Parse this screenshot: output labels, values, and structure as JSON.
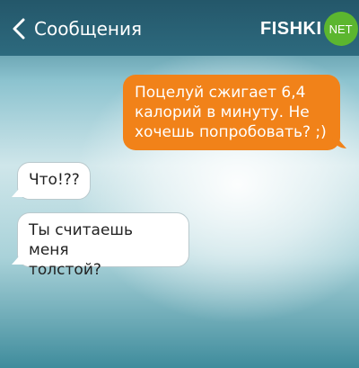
{
  "navbar": {
    "back_label": "Сообщения",
    "brand_main": "FISHKI",
    "brand_badge": "NET",
    "colors": {
      "bar": "#2d6a7e",
      "badge": "#5cb62f"
    }
  },
  "messages": [
    {
      "direction": "outgoing",
      "text_line1": "Поцелуй сжигает 6,4",
      "text_line2": "калорий в минуту. Не",
      "text_line3": "хочешь попробовать? ;)",
      "color": "#f18219"
    },
    {
      "direction": "incoming",
      "text": "Что!??",
      "color": "#ffffff"
    },
    {
      "direction": "incoming",
      "text_line1": "Ты считаешь меня",
      "text_line2": "толстой?",
      "color": "#ffffff"
    }
  ]
}
